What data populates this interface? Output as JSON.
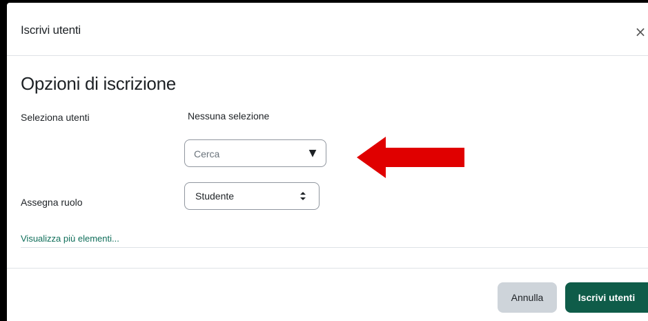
{
  "modal": {
    "title": "Iscrivi utenti",
    "close_label": "×"
  },
  "enrolment_options": {
    "heading": "Opzioni di iscrizione",
    "select_users": {
      "label": "Seleziona utenti",
      "selection_text": "Nessuna selezione",
      "search_placeholder": "Cerca",
      "dropdown_glyph": "▼"
    },
    "assign_role": {
      "label": "Assegna ruolo",
      "selected_value": "Studente"
    },
    "show_more_link": "Visualizza più elementi..."
  },
  "footer": {
    "cancel_label": "Annulla",
    "enrol_label": "Iscrivi utenti"
  },
  "colors": {
    "accent": "#0f5c49",
    "link": "#0f6e5a",
    "annotation_arrow": "#e00000"
  }
}
